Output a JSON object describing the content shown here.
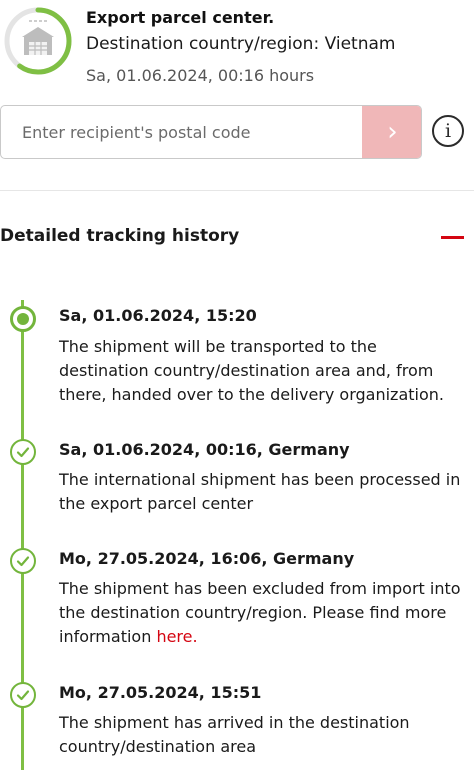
{
  "status": {
    "title": "Export parcel center.",
    "subtitle": "Destination country/region: Vietnam",
    "timestamp": "Sa, 01.06.2024, 00:16 hours",
    "icon": "warehouse-icon",
    "progress": 0.6,
    "accent_color": "#7fbf44"
  },
  "postal": {
    "placeholder": "Enter recipient's postal code",
    "submit_icon": "chevron-right-icon",
    "submit_color": "#f0b7b8",
    "info_icon": "info-icon"
  },
  "history": {
    "title": "Detailed tracking history",
    "collapse_icon": "minus-icon",
    "accent_color": "#d40511",
    "events": [
      {
        "title": "Sa, 01.06.2024, 15:20",
        "text": "The shipment will be transported to the destination country/destination area and, from there, handed over to the delivery organization.",
        "marker": "current-dot-icon"
      },
      {
        "title": "Sa, 01.06.2024, 00:16, Germany",
        "text": "The international shipment has been processed in the export parcel center",
        "marker": "check-icon"
      },
      {
        "title": "Mo, 27.05.2024, 16:06, Germany",
        "text": "The shipment has been excluded from import into the destination country/region. Please find more information ",
        "link": "here.",
        "marker": "check-icon"
      },
      {
        "title": "Mo, 27.05.2024, 15:51",
        "text": "The shipment has arrived in the destination country/destination area",
        "marker": "check-icon"
      }
    ]
  }
}
